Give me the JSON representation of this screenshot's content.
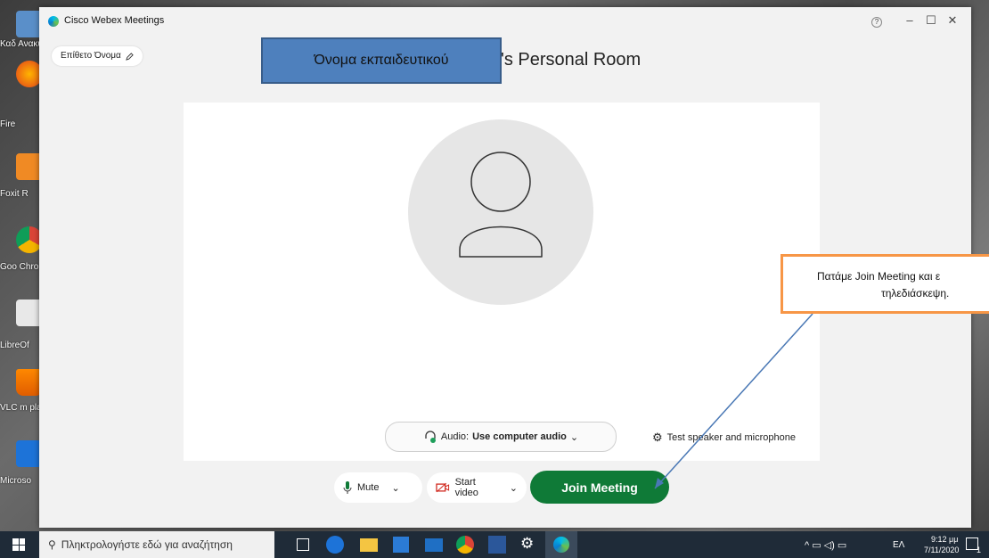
{
  "window": {
    "title": "Cisco Webex Meetings",
    "help": "?",
    "minimize": "–",
    "maximize": "☐",
    "close": "✕"
  },
  "profile": {
    "name_label": "Επίθετο Όνομα"
  },
  "room": {
    "title": "'s Personal Room"
  },
  "annotation": {
    "teacher_label": "Όνομα εκπαιδευτικού",
    "callout_line1": "Πατάμε Join Meeting και ε",
    "callout_line2": "τηλεδιάσκεψη."
  },
  "audio": {
    "prefix": "Audio:",
    "value": "Use computer audio"
  },
  "test_link": "Test speaker and microphone",
  "controls": {
    "mute": "Mute",
    "video": "Start video",
    "join": "Join Meeting"
  },
  "desktop_icons": [
    "Καδ Ανακύκλ",
    "Fire",
    "Foxit R",
    "Goo Chro",
    "LibreOf",
    "VLC m pla",
    "Microso"
  ],
  "taskbar": {
    "search_placeholder": "Πληκτρολογήστε εδώ για αναζήτηση",
    "lang": "ΕΛ",
    "time": "9:12 μμ",
    "date": "7/11/2020",
    "notification_count": "1"
  },
  "colors": {
    "join": "#0f7a37",
    "callout_border": "#f79646",
    "teacher_box": "#4e80bd"
  },
  "icons": [
    "windows-icon",
    "search-icon",
    "task-view-icon",
    "edge-icon",
    "file-explorer-icon",
    "store-icon",
    "mail-icon",
    "chrome-icon",
    "word-icon",
    "settings-icon",
    "webex-icon"
  ]
}
